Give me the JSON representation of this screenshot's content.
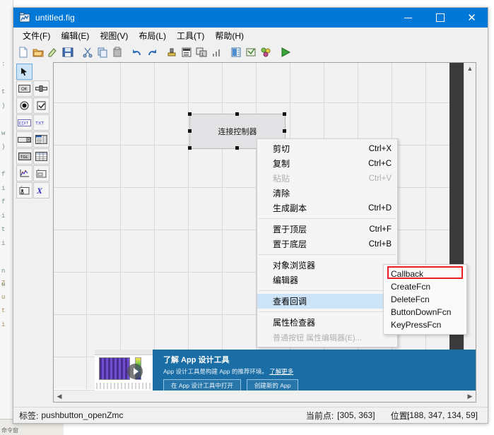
{
  "window": {
    "title": "untitled.fig",
    "icon": "figure-file-icon",
    "controls": {
      "minimize": "minimize-icon",
      "maximize": "maximize-icon",
      "close": "close-icon"
    }
  },
  "menubar": {
    "items": [
      {
        "label": "文件(F)",
        "key": "F"
      },
      {
        "label": "编辑(E)",
        "key": "E"
      },
      {
        "label": "视图(V)",
        "key": "V"
      },
      {
        "label": "布局(L)",
        "key": "L"
      },
      {
        "label": "工具(T)",
        "key": "T"
      },
      {
        "label": "帮助(H)",
        "key": "H"
      }
    ]
  },
  "toolbar": {
    "buttons": [
      {
        "name": "new-file-icon"
      },
      {
        "name": "open-folder-icon"
      },
      {
        "name": "save-as-icon"
      },
      {
        "name": "save-icon"
      },
      {
        "name": "cut-icon"
      },
      {
        "name": "copy-icon"
      },
      {
        "name": "paste-icon"
      },
      {
        "name": "undo-icon"
      },
      {
        "name": "redo-icon"
      },
      {
        "name": "align-objects-icon"
      },
      {
        "name": "menu-editor-icon"
      },
      {
        "name": "tab-order-editor-icon"
      },
      {
        "name": "toolbar-editor-icon"
      },
      {
        "name": "m-file-editor-icon"
      },
      {
        "name": "property-inspector-icon"
      },
      {
        "name": "object-browser-icon"
      },
      {
        "name": "run-icon"
      }
    ]
  },
  "palette": {
    "items": [
      {
        "name": "select-tool",
        "glyph": "arrow",
        "selected": true
      },
      {
        "name": "push-button-tool",
        "glyph": "OK"
      },
      {
        "name": "slider-tool",
        "glyph": "slider"
      },
      {
        "name": "radio-button-tool",
        "glyph": "radio"
      },
      {
        "name": "check-box-tool",
        "glyph": "check"
      },
      {
        "name": "edit-text-tool",
        "glyph": "EDIT"
      },
      {
        "name": "static-text-tool",
        "glyph": "TXT"
      },
      {
        "name": "pop-up-menu-tool",
        "glyph": "popup"
      },
      {
        "name": "listbox-tool",
        "glyph": "list"
      },
      {
        "name": "toggle-button-tool",
        "glyph": "TGL"
      },
      {
        "name": "table-tool",
        "glyph": "table"
      },
      {
        "name": "axes-tool",
        "glyph": "axes"
      },
      {
        "name": "panel-tool",
        "glyph": "panel"
      },
      {
        "name": "button-group-tool",
        "glyph": "group"
      },
      {
        "name": "activex-control-tool",
        "glyph": "X"
      }
    ]
  },
  "canvas": {
    "component": {
      "label": "连接控制器",
      "tag": "pushbutton_openZmc",
      "selected": true
    }
  },
  "context_menu": {
    "items": [
      {
        "label": "剪切",
        "accel": "Ctrl+X",
        "state": "normal"
      },
      {
        "label": "复制",
        "accel": "Ctrl+C",
        "state": "normal"
      },
      {
        "label": "粘贴",
        "accel": "Ctrl+V",
        "state": "disabled"
      },
      {
        "label": "清除",
        "accel": "",
        "state": "normal"
      },
      {
        "label": "生成副本",
        "accel": "Ctrl+D",
        "state": "normal"
      },
      {
        "separator": true
      },
      {
        "label": "置于顶层",
        "accel": "Ctrl+F",
        "state": "normal"
      },
      {
        "label": "置于底层",
        "accel": "Ctrl+B",
        "state": "normal"
      },
      {
        "separator": true
      },
      {
        "label": "对象浏览器",
        "accel": "",
        "state": "normal"
      },
      {
        "label": "编辑器",
        "accel": "",
        "state": "normal"
      },
      {
        "separator": true
      },
      {
        "label": "查看回调",
        "accel": "",
        "state": "highlighted",
        "submenu": true
      },
      {
        "separator": true
      },
      {
        "label": "属性检查器",
        "accel": "",
        "state": "normal"
      },
      {
        "label": "普通按钮 属性编辑器(E)...",
        "accel": "",
        "state": "disabled"
      }
    ]
  },
  "submenu": {
    "items": [
      {
        "label": "Callback",
        "highlighted": true
      },
      {
        "label": "CreateFcn",
        "highlighted": false
      },
      {
        "label": "DeleteFcn",
        "highlighted": false
      },
      {
        "label": "ButtonDownFcn",
        "highlighted": false
      },
      {
        "label": "KeyPressFcn",
        "highlighted": false
      }
    ],
    "annotation_color": "#ee1c25"
  },
  "banner": {
    "title": "了解 App 设计工具",
    "subtitle": "App 设计工具是构建 App 的推荐环境。",
    "link": "了解更多",
    "buttons": [
      "在 App 设计工具中打开",
      "创建新的 App"
    ],
    "close": "minimize-banner-icon",
    "play": "play-video-icon"
  },
  "statusbar": {
    "tag_label": "标签:",
    "tag_value": "pushbutton_openZmc",
    "current_point_label": "当前点:",
    "current_point_value": "[305, 363]",
    "position_label": "位置:",
    "position_value": "[188, 347, 134, 59]"
  },
  "background": {
    "left_column_text": ":\n\nt\n)\n\nw\n)\n\nf\ni\nf\ni\nt\ni\n\nn\nu",
    "left_column_text2": "Z\nu\nt\ni",
    "taskbar_text": "命令窗"
  },
  "colors": {
    "titlebar": "#0078d7",
    "banner": "#1b6ea5",
    "menu_highlight": "#cde3f7",
    "annotation": "#ee1c25",
    "canvas_grid": "#d8d8d8"
  }
}
